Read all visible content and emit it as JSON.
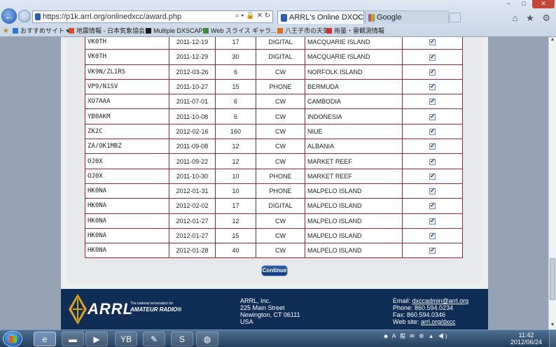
{
  "browser": {
    "url": "https://p1k.arrl.org/onlinedxcc/award.php",
    "tabs": [
      {
        "label": "ARRL's Online DXCC",
        "active": true
      },
      {
        "label": "Google",
        "active": false
      }
    ],
    "window_controls": {
      "minimize": "−",
      "maximize": "□",
      "close": "✕"
    },
    "tools_icons": "⌂ ★ ⚙",
    "favorites_bar": [
      {
        "label": "おすすめサイト ▾",
        "icon_color": "#2b7bd4"
      },
      {
        "label": "地震情報 - 日本気象協会...",
        "icon_color": "#d94a2b"
      },
      {
        "label": "Multiple DXSCAPE",
        "icon_color": "#1a1a1a"
      },
      {
        "label": "Web スライス ギャラ... ▾",
        "icon_color": "#3d8d3a"
      },
      {
        "label": "八王子市の天気",
        "icon_color": "#e06c20"
      },
      {
        "label": "雨量・雷観測情報",
        "icon_color": "#d0302a"
      }
    ]
  },
  "table": {
    "rows": [
      {
        "call": "VK0TH",
        "date": "2011-12-19",
        "band": "17",
        "mode": "DIGITAL",
        "entity": "MACQUARIE ISLAND",
        "checked": true
      },
      {
        "call": "VK0TH",
        "date": "2011-12-29",
        "band": "30",
        "mode": "DIGITAL",
        "entity": "MACQUARIE ISLAND",
        "checked": true
      },
      {
        "call": "VK9N/ZL1RS",
        "date": "2012-03-26",
        "band": "6",
        "mode": "CW",
        "entity": "NORFOLK ISLAND",
        "checked": true
      },
      {
        "call": "VP9/N1SV",
        "date": "2011-10-27",
        "band": "15",
        "mode": "PHONE",
        "entity": "BERMUDA",
        "checked": true
      },
      {
        "call": "XU7AAA",
        "date": "2011-07-01",
        "band": "6",
        "mode": "CW",
        "entity": "CAMBODIA",
        "checked": true
      },
      {
        "call": "YB0AKM",
        "date": "2011-10-08",
        "band": "6",
        "mode": "CW",
        "entity": "INDONESIA",
        "checked": true
      },
      {
        "call": "ZK2C",
        "date": "2012-02-16",
        "band": "160",
        "mode": "CW",
        "entity": "NIUE",
        "checked": true
      },
      {
        "call": "ZA/OK1MBZ",
        "date": "2011-09-08",
        "band": "12",
        "mode": "CW",
        "entity": "ALBANIA",
        "checked": true
      },
      {
        "call": "OJ0X",
        "date": "2011-09-22",
        "band": "12",
        "mode": "CW",
        "entity": "MARKET REEF",
        "checked": true
      },
      {
        "call": "OJ0X",
        "date": "2011-10-30",
        "band": "10",
        "mode": "PHONE",
        "entity": "MARKET REEF",
        "checked": true
      },
      {
        "call": "HK0NA",
        "date": "2012-01-31",
        "band": "10",
        "mode": "PHONE",
        "entity": "MALPELO ISLAND",
        "checked": true
      },
      {
        "call": "HK0NA",
        "date": "2012-02-02",
        "band": "17",
        "mode": "DIGITAL",
        "entity": "MALPELO ISLAND",
        "checked": true
      },
      {
        "call": "HK0NA",
        "date": "2012-01-27",
        "band": "12",
        "mode": "CW",
        "entity": "MALPELO ISLAND",
        "checked": true
      },
      {
        "call": "HK0NA",
        "date": "2012-01-27",
        "band": "15",
        "mode": "CW",
        "entity": "MALPELO ISLAND",
        "checked": true
      },
      {
        "call": "HK0NA",
        "date": "2012-01-28",
        "band": "40",
        "mode": "CW",
        "entity": "MALPELO ISLAND",
        "checked": true
      }
    ]
  },
  "continue_label": "Continue",
  "footer": {
    "logo_text": "ARRL",
    "tagline_1": "The national association for",
    "tagline_2": "AMATEUR RADIO®",
    "org_name": "ARRL, Inc.",
    "street": "225 Main Street",
    "city": "Newington, CT 06111",
    "country": "USA",
    "email_label": "Email: ",
    "email": "dxccadmin@arrl.org",
    "phone": "Phone: 860.594.0234",
    "fax": "Fax: 860.594.0346",
    "web_label": "Web site: ",
    "web": "arrl.org/dxcc"
  },
  "taskbar": {
    "apps": [
      {
        "name": "internet-explorer",
        "glyph": "e",
        "active": true
      },
      {
        "name": "file-explorer",
        "glyph": "▬",
        "active": false
      },
      {
        "name": "media-player",
        "glyph": "▶",
        "active": false
      },
      {
        "name": "app-yb",
        "glyph": "YB",
        "active": false
      },
      {
        "name": "paint",
        "glyph": "✎",
        "active": false
      },
      {
        "name": "skype",
        "glyph": "S",
        "active": false
      },
      {
        "name": "globe-app",
        "glyph": "◍",
        "active": false
      }
    ],
    "tray": "◆ A 般 ✉ ⚙ ▲ ◀)",
    "time": "11:42",
    "date": "2012/06/24"
  },
  "colors": {
    "table_border": "#8e2c3b",
    "footer_bg": "#102e55",
    "continue_bg": "#1a4a8f"
  }
}
